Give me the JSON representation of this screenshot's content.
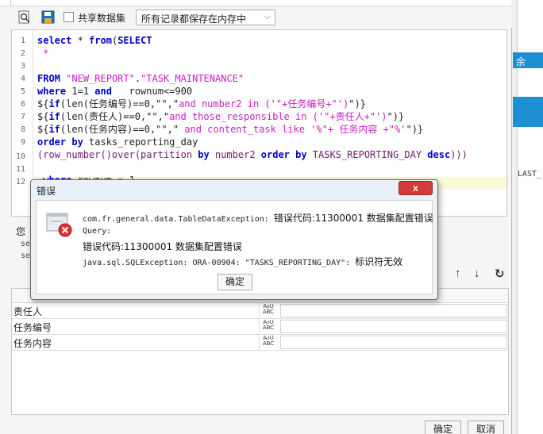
{
  "toolbar": {
    "share_label": "共享数据集",
    "storage_select": "所有记录都保存在内存中",
    "preview_icon": "preview-icon",
    "save_icon": "save-icon"
  },
  "editor": {
    "line_numbers": [
      "1",
      "2",
      "3",
      "4",
      "5",
      "6",
      "7",
      "8",
      "9",
      "10",
      "11",
      "12"
    ]
  },
  "hint": {
    "text": "您",
    "s1": "se",
    "s2": "se"
  },
  "params": {
    "rows": [
      {
        "name": "责任人",
        "type_icon": "AoU ABC"
      },
      {
        "name": "任务编号",
        "type_icon": "AoU ABC"
      },
      {
        "name": "任务内容",
        "type_icon": "AoU ABC"
      }
    ]
  },
  "buttons": {
    "ok": "确定",
    "cancel": "取消"
  },
  "background_panel": {
    "label": "余",
    "code": "LAST_"
  },
  "error_dialog": {
    "title": "错误",
    "close": "x",
    "line1_mono": "com.fr.general.data.TableDataException: ",
    "line1_cjk": "错误代码:11300001 数据集配置错误",
    "line2": "Query:",
    "line3": "错误代码:11300001 数据集配置错误",
    "line4_mono": "java.sql.SQLException: ORA-00904: \"TASKS_REPORTING_DAY\": ",
    "line4_cjk": "标识符无效",
    "ok": "确定"
  },
  "colors": {
    "keyword": "#0000c8",
    "string": "#c81ec8",
    "close": "#d13b3b",
    "blue": "#1f8fd4"
  }
}
